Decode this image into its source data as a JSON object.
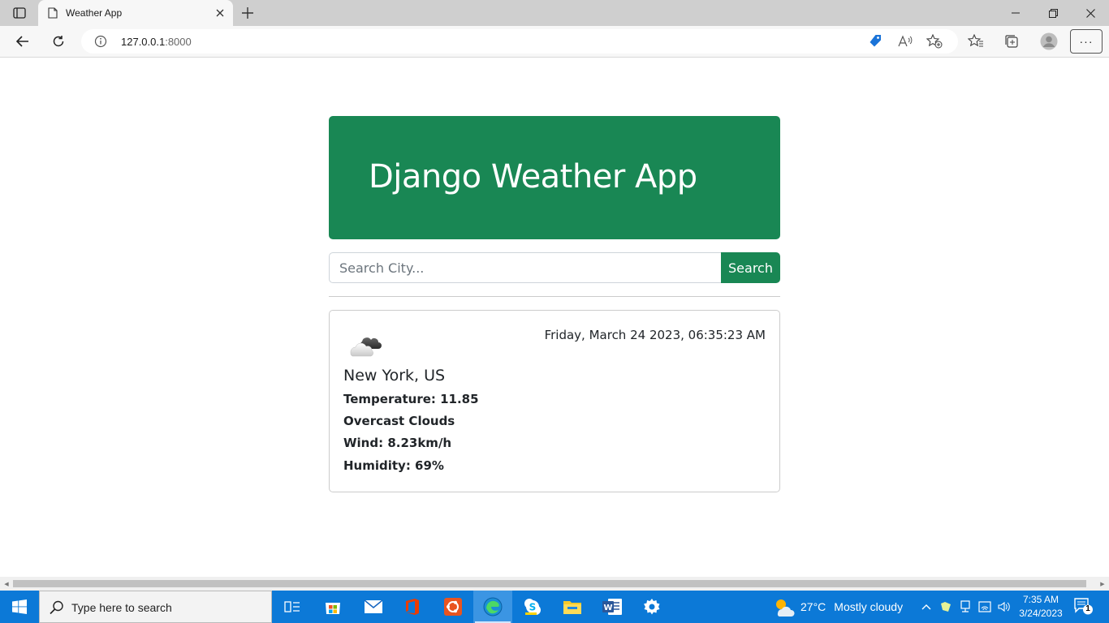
{
  "browser": {
    "tab_title": "Weather App",
    "url_host": "127.0.0.1",
    "url_port": ":8000",
    "more_label": "···"
  },
  "app": {
    "title": "Django Weather App",
    "search_placeholder": "Search City...",
    "search_button": "Search",
    "accent_color": "#198754"
  },
  "weather": {
    "icon": "overcast-clouds-icon",
    "datetime": "Friday, March 24 2023, 06:35:23 AM",
    "city": "New York, US",
    "temperature": "Temperature: 11.85",
    "description": "Overcast Clouds",
    "wind": "Wind: 8.23km/h",
    "humidity": "Humidity: 69%"
  },
  "taskbar": {
    "search_placeholder": "Type here to search",
    "weather_temp": "27°C",
    "weather_condition": "Mostly cloudy",
    "time": "7:35 AM",
    "date": "3/24/2023",
    "notification_count": "1"
  }
}
